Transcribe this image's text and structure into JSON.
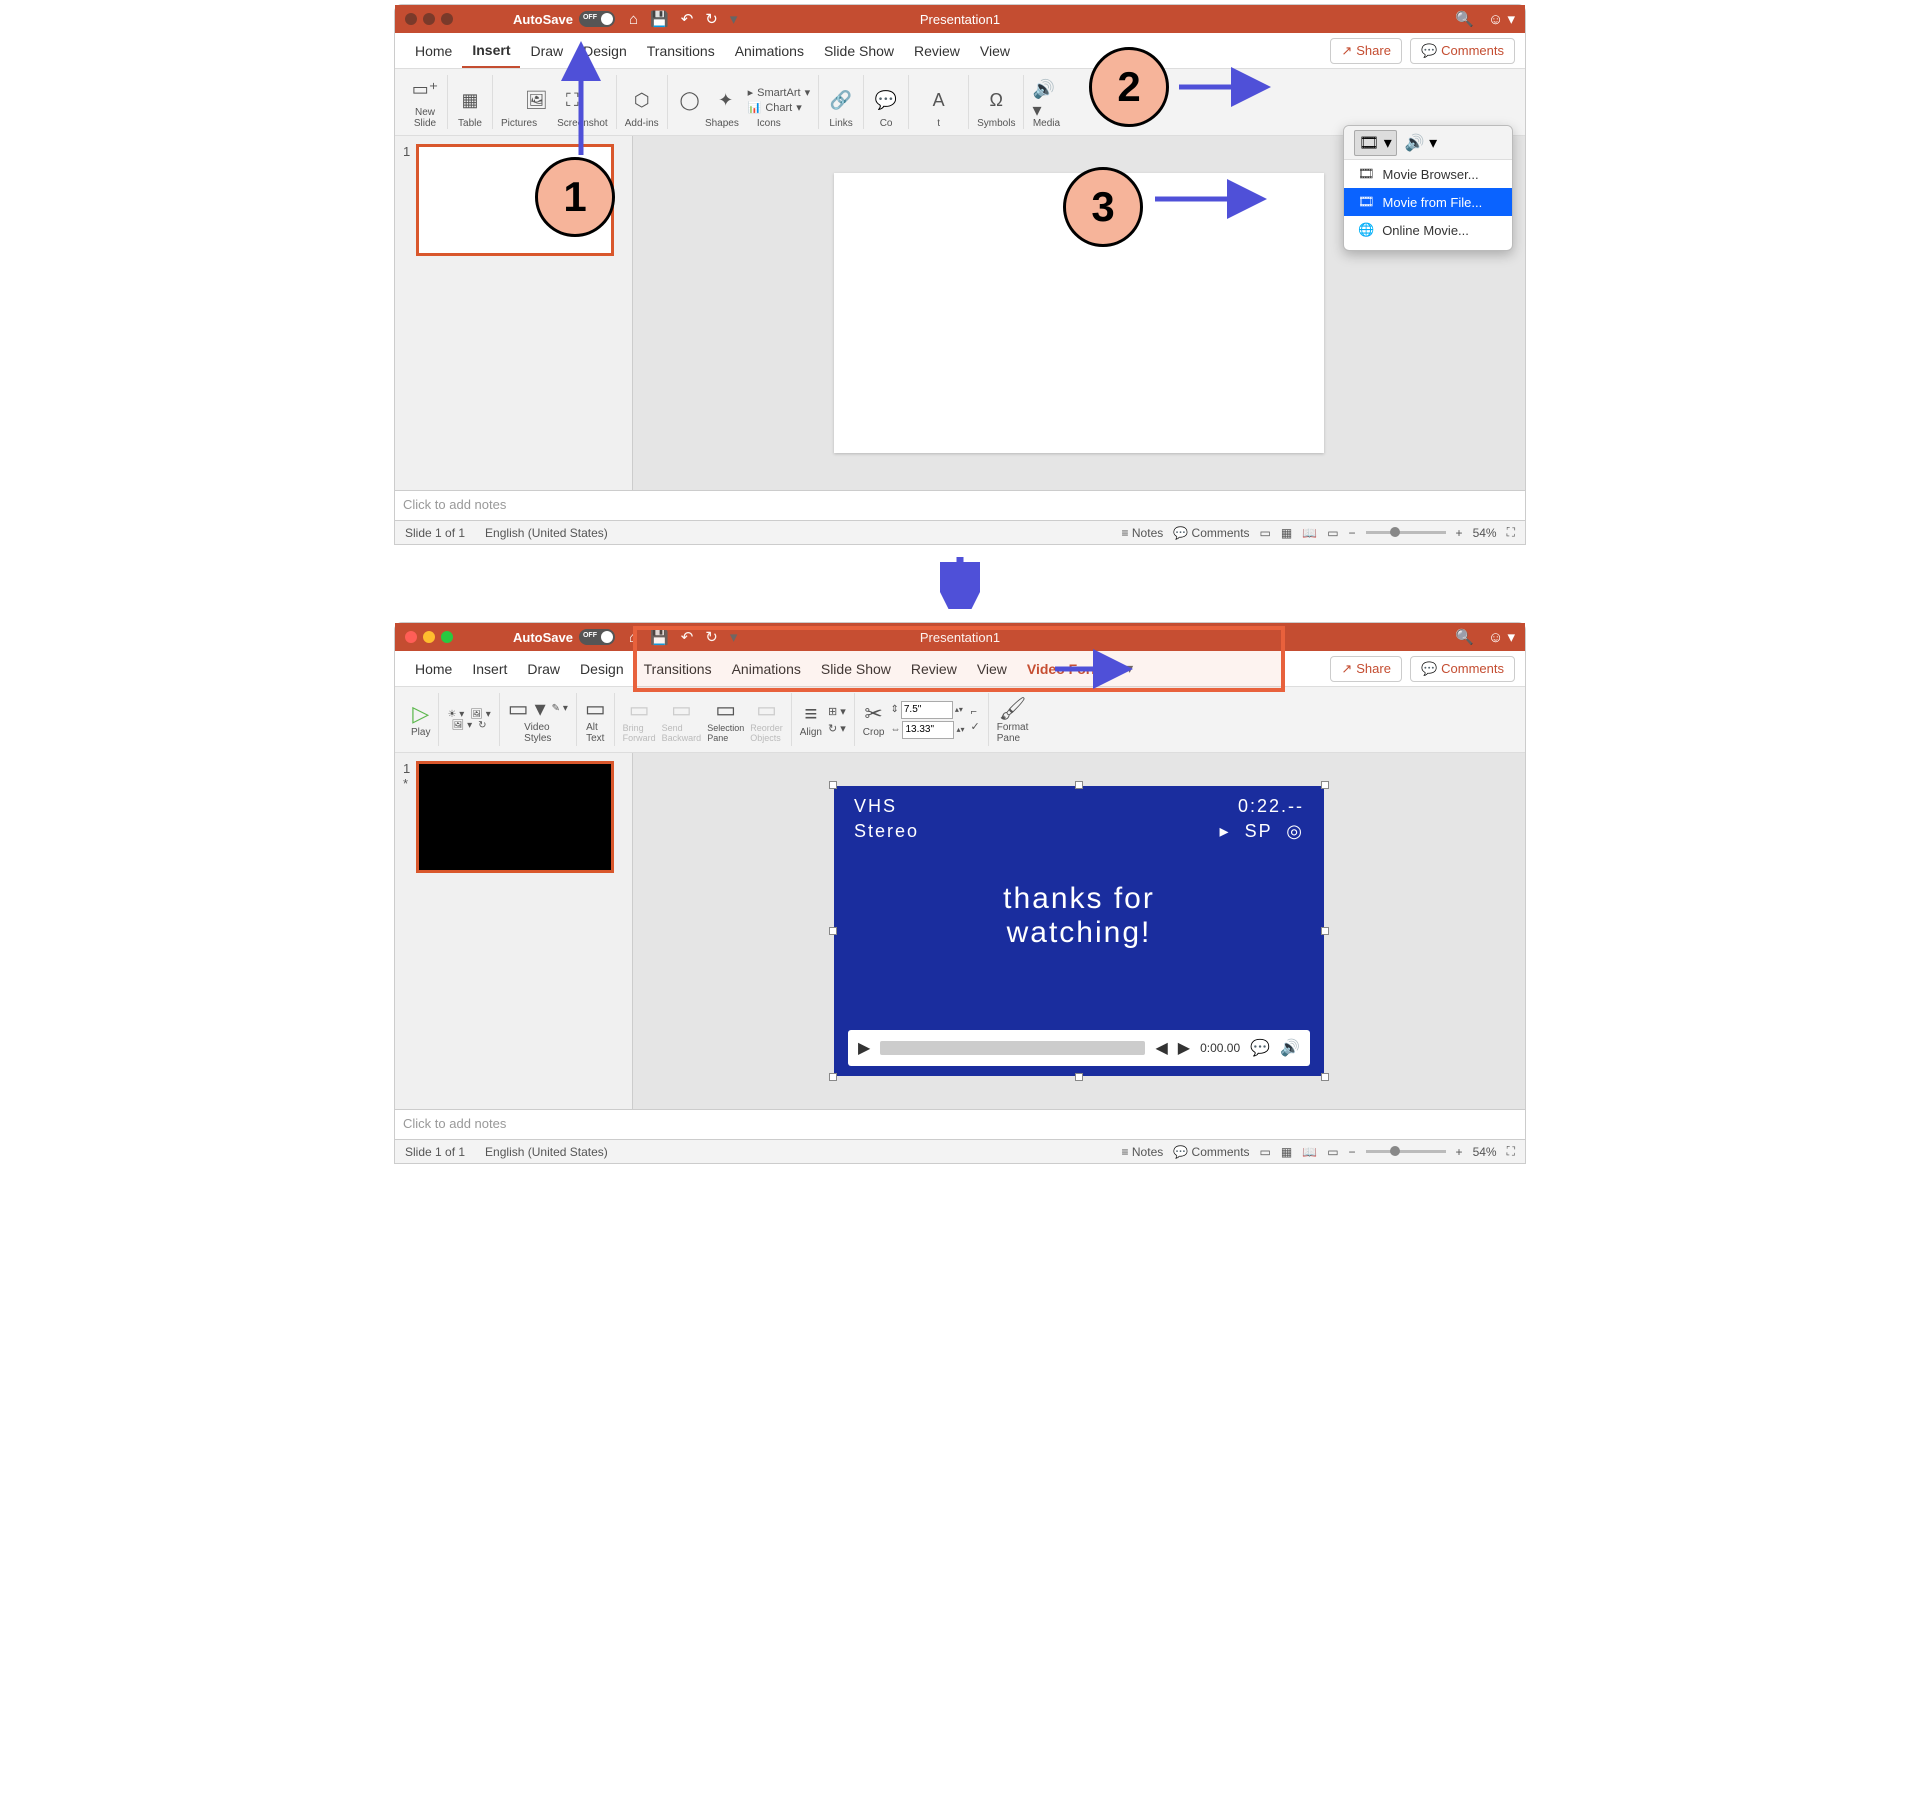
{
  "window1": {
    "title": "Presentation1",
    "autosave_label": "AutoSave",
    "tabs": [
      "Home",
      "Insert",
      "Draw",
      "Design",
      "Transitions",
      "Animations",
      "Slide Show",
      "Review",
      "View"
    ],
    "active_tab": "Insert",
    "share": "Share",
    "comments": "Comments",
    "ribbon": {
      "new_slide": "New\nSlide",
      "table": "Table",
      "pictures": "Pictures",
      "screenshot": "Screenshot",
      "addins": "Add-ins",
      "shapes": "Shapes",
      "icons": "Icons",
      "smartart": "SmartArt",
      "chart": "Chart",
      "links": "Links",
      "comment_hidden": "Co",
      "t_hidden": "t",
      "symbols": "Symbols",
      "media": "Media"
    },
    "dropdown": {
      "browser": "Movie Browser...",
      "from_file": "Movie from File...",
      "online": "Online Movie..."
    },
    "notes_placeholder": "Click to add notes",
    "status": {
      "slide_info": "Slide 1 of 1",
      "language": "English (United States)",
      "notes": "Notes",
      "comments": "Comments",
      "zoom": "54%"
    },
    "thumb_number": "1"
  },
  "window2": {
    "title": "Presentation1",
    "autosave_label": "AutoSave",
    "tabs": [
      "Home",
      "Insert",
      "Draw",
      "Design",
      "Transitions",
      "Animations",
      "Slide Show",
      "Review",
      "View",
      "Video Format"
    ],
    "share": "Share",
    "comments": "Comments",
    "ribbon": {
      "play": "Play",
      "video_styles": "Video\nStyles",
      "alt_text": "Alt\nText",
      "bring_forward": "Bring\nForward",
      "send_backward": "Send\nBackward",
      "selection_pane": "Selection\nPane",
      "reorder_objects": "Reorder\nObjects",
      "align": "Align",
      "crop": "Crop",
      "height": "7.5\"",
      "width": "13.33\"",
      "format_pane": "Format\nPane"
    },
    "video": {
      "vhs": "VHS",
      "stereo": "Stereo",
      "time": "0:22.--",
      "sp": "SP",
      "thanks1": "thanks for",
      "thanks2": "watching!",
      "play_time": "0:00.00"
    },
    "notes_placeholder": "Click to add notes",
    "status": {
      "slide_info": "Slide 1 of 1",
      "language": "English (United States)",
      "notes": "Notes",
      "comments": "Comments",
      "zoom": "54%"
    },
    "thumb_number": "1",
    "thumb_marker": "*"
  },
  "annotations": {
    "step1": "1",
    "step2": "2",
    "step3": "3"
  }
}
